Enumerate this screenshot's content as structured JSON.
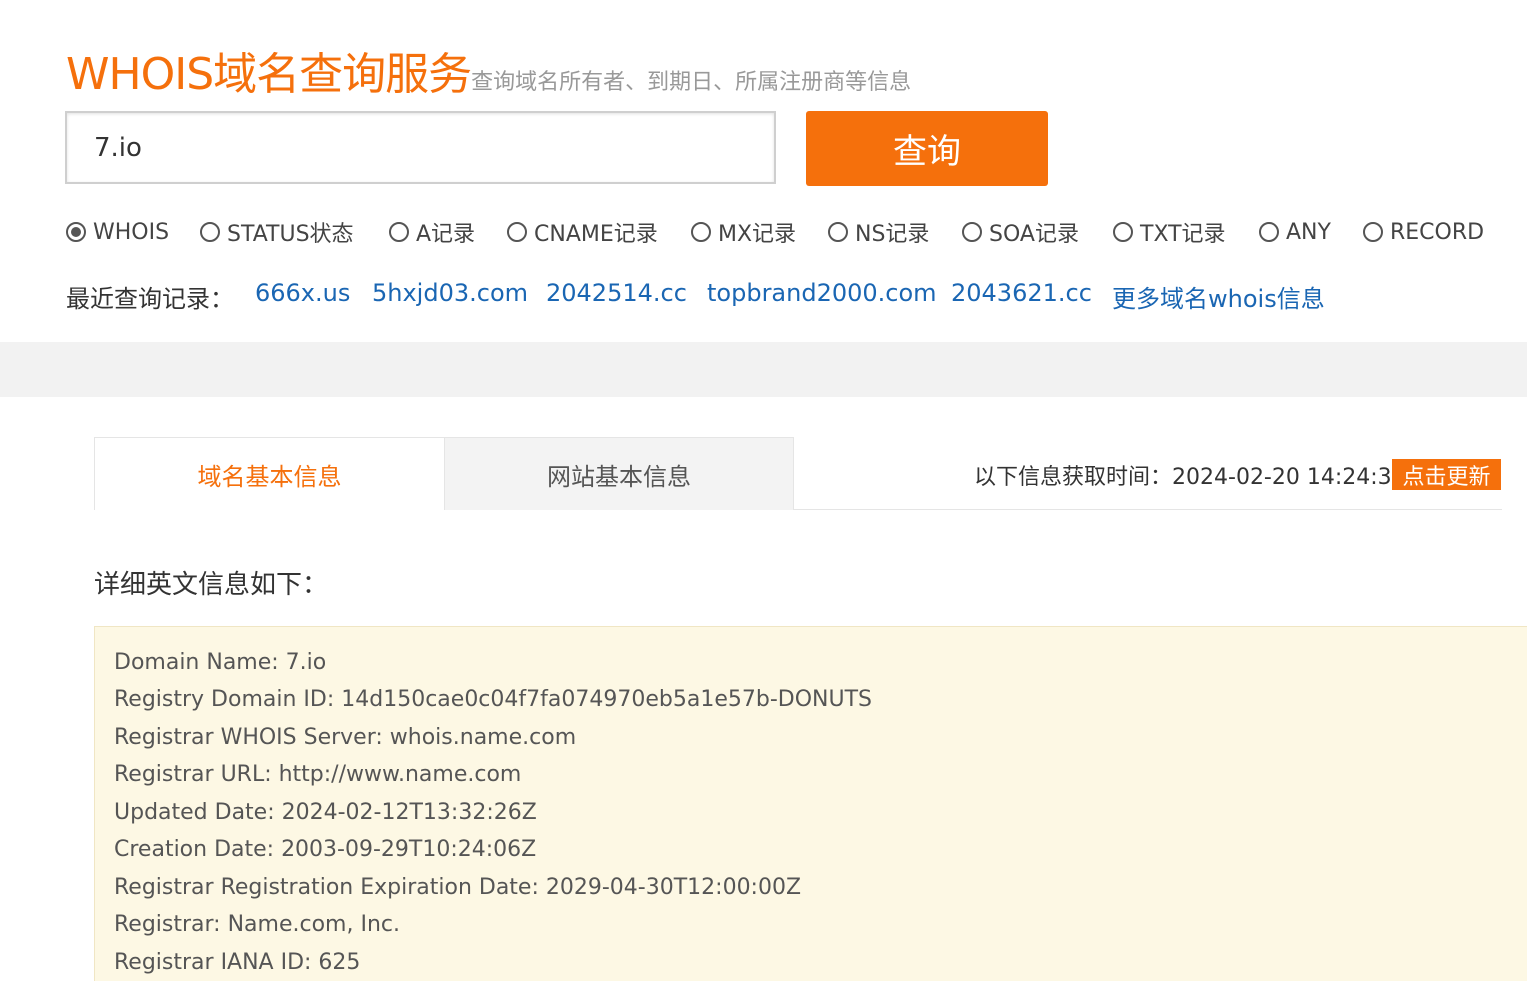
{
  "header": {
    "title": "WHOIS域名查询服务",
    "subtitle": "查询域名所有者、到期日、所属注册商等信息"
  },
  "search": {
    "value": "7.io",
    "button_label": "查询"
  },
  "record_types": [
    {
      "label": "WHOIS",
      "checked": true
    },
    {
      "label": "STATUS状态",
      "checked": false
    },
    {
      "label": "A记录",
      "checked": false
    },
    {
      "label": "CNAME记录",
      "checked": false
    },
    {
      "label": "MX记录",
      "checked": false
    },
    {
      "label": "NS记录",
      "checked": false
    },
    {
      "label": "SOA记录",
      "checked": false
    },
    {
      "label": "TXT记录",
      "checked": false
    },
    {
      "label": "ANY",
      "checked": false
    },
    {
      "label": "RECORD",
      "checked": false
    }
  ],
  "recent": {
    "label": "最近查询记录：",
    "links": [
      "666x.us",
      "5hxjd03.com",
      "2042514.cc",
      "topbrand2000.com",
      "2043621.cc"
    ],
    "more_label": "更多域名whois信息"
  },
  "tabs": {
    "domain_info": "域名基本信息",
    "site_info": "网站基本信息"
  },
  "fetch": {
    "label": "以下信息获取时间：",
    "time": "2024-02-20 14:24:31",
    "refresh_label": "点击更新"
  },
  "detail": {
    "heading": "详细英文信息如下：",
    "lines": [
      "Domain Name: 7.io",
      "Registry Domain ID: 14d150cae0c04f7fa074970eb5a1e57b-DONUTS",
      "Registrar WHOIS Server: whois.name.com",
      "Registrar URL: http://www.name.com",
      "Updated Date: 2024-02-12T13:32:26Z",
      "Creation Date: 2003-09-29T10:24:06Z",
      "Registrar Registration Expiration Date: 2029-04-30T12:00:00Z",
      "Registrar: Name.com, Inc.",
      "Registrar IANA ID: 625"
    ]
  },
  "colors": {
    "accent": "#f5700c",
    "link": "#1a66b3",
    "whois_bg": "#fdf8e4"
  }
}
